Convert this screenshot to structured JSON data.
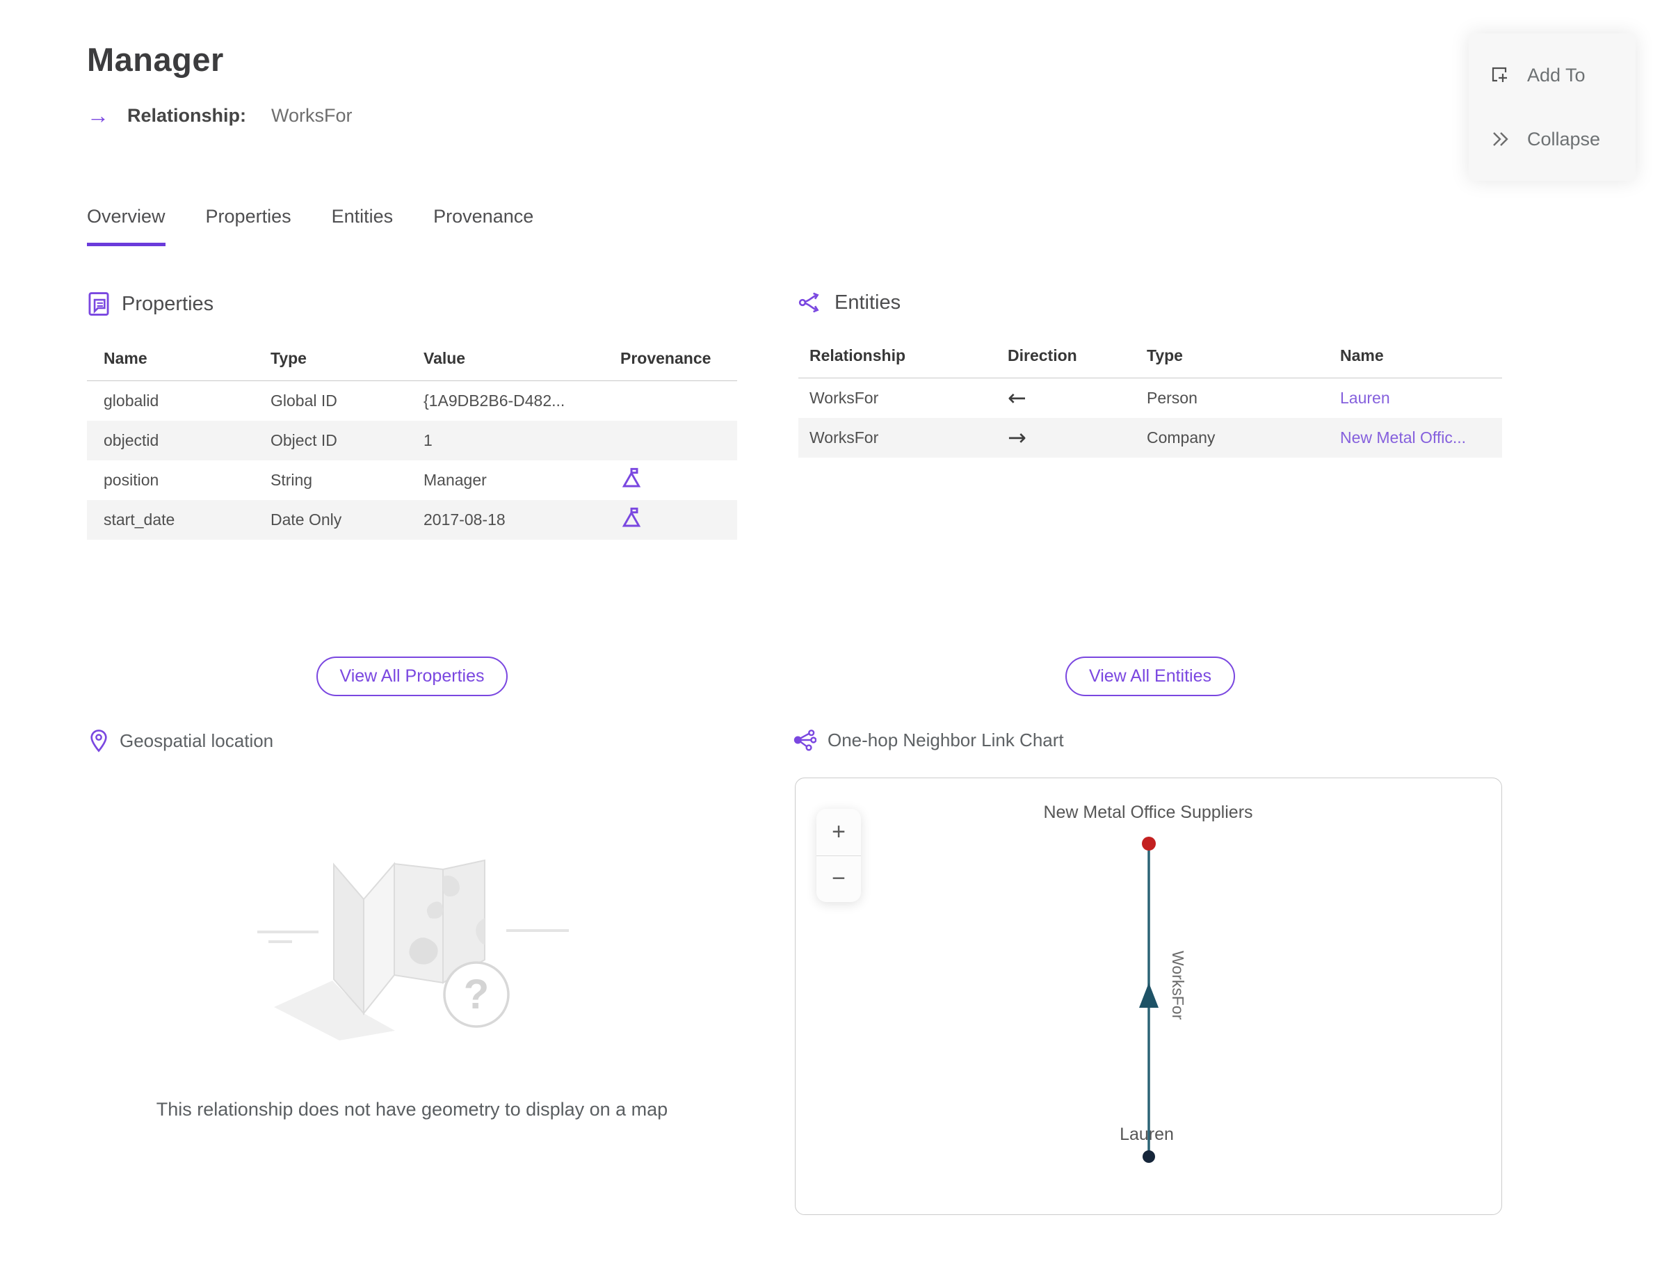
{
  "header": {
    "title": "Manager",
    "relationship_label": "Relationship:",
    "relationship_value": "WorksFor",
    "relationship_arrow": "→"
  },
  "actions": {
    "add_to_label": "Add To",
    "collapse_label": "Collapse"
  },
  "tabs": {
    "overview": "Overview",
    "properties": "Properties",
    "entities": "Entities",
    "provenance": "Provenance"
  },
  "properties_section": {
    "title": "Properties",
    "columns": [
      "Name",
      "Type",
      "Value",
      "Provenance"
    ],
    "rows": [
      {
        "name": "globalid",
        "type": "Global ID",
        "value": "{1A9DB2B6-D482...",
        "has_provenance": false
      },
      {
        "name": "objectid",
        "type": "Object ID",
        "value": "1",
        "has_provenance": false
      },
      {
        "name": "position",
        "type": "String",
        "value": "Manager",
        "has_provenance": true
      },
      {
        "name": "start_date",
        "type": "Date Only",
        "value": "2017-08-18",
        "has_provenance": true
      }
    ],
    "view_all_label": "View All Properties"
  },
  "entities_section": {
    "title": "Entities",
    "columns": [
      "Relationship",
      "Direction",
      "Type",
      "Name"
    ],
    "rows": [
      {
        "relationship": "WorksFor",
        "direction": "←",
        "type": "Person",
        "name": "Lauren"
      },
      {
        "relationship": "WorksFor",
        "direction": "→",
        "type": "Company",
        "name": "New Metal Offic..."
      }
    ],
    "view_all_label": "View All Entities"
  },
  "geospatial_section": {
    "title": "Geospatial location",
    "empty_message": "This relationship does not have geometry to display on a map"
  },
  "link_chart_section": {
    "title": "One-hop Neighbor Link Chart",
    "zoom_in_label": "+",
    "zoom_out_label": "−",
    "chart_data": {
      "type": "node-link",
      "nodes": [
        {
          "id": "company",
          "label": "New Metal Office Suppliers",
          "color": "#c32020"
        },
        {
          "id": "person",
          "label": "Lauren",
          "color": "#16263a"
        }
      ],
      "edges": [
        {
          "source": "person",
          "target": "company",
          "label": "WorksFor",
          "color": "#2b6375"
        }
      ],
      "legend": "arrow points from Lauren to New Metal Office Suppliers"
    }
  },
  "colors": {
    "accent": "#7a47e0",
    "link": "#8560dd",
    "edge_teal": "#2b6375",
    "node_red": "#c32020",
    "node_dark": "#16263a",
    "row_stripe": "#f4f4f4"
  }
}
